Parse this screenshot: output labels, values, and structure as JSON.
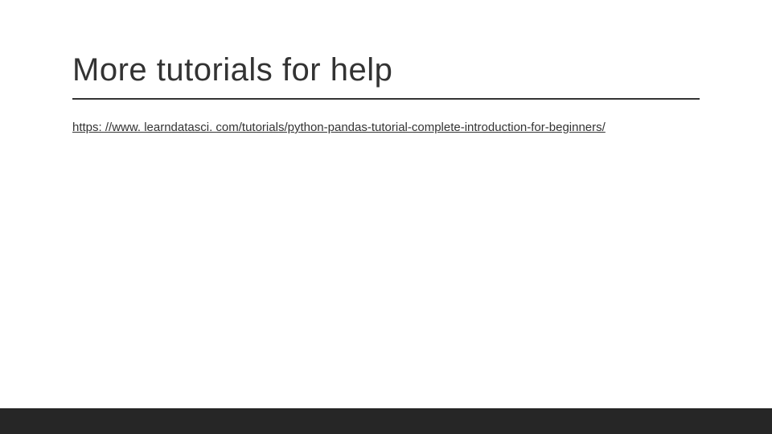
{
  "slide": {
    "title": "More tutorials for help",
    "link_text": "https: //www. learndatasci. com/tutorials/python-pandas-tutorial-complete-introduction-for-beginners/"
  }
}
